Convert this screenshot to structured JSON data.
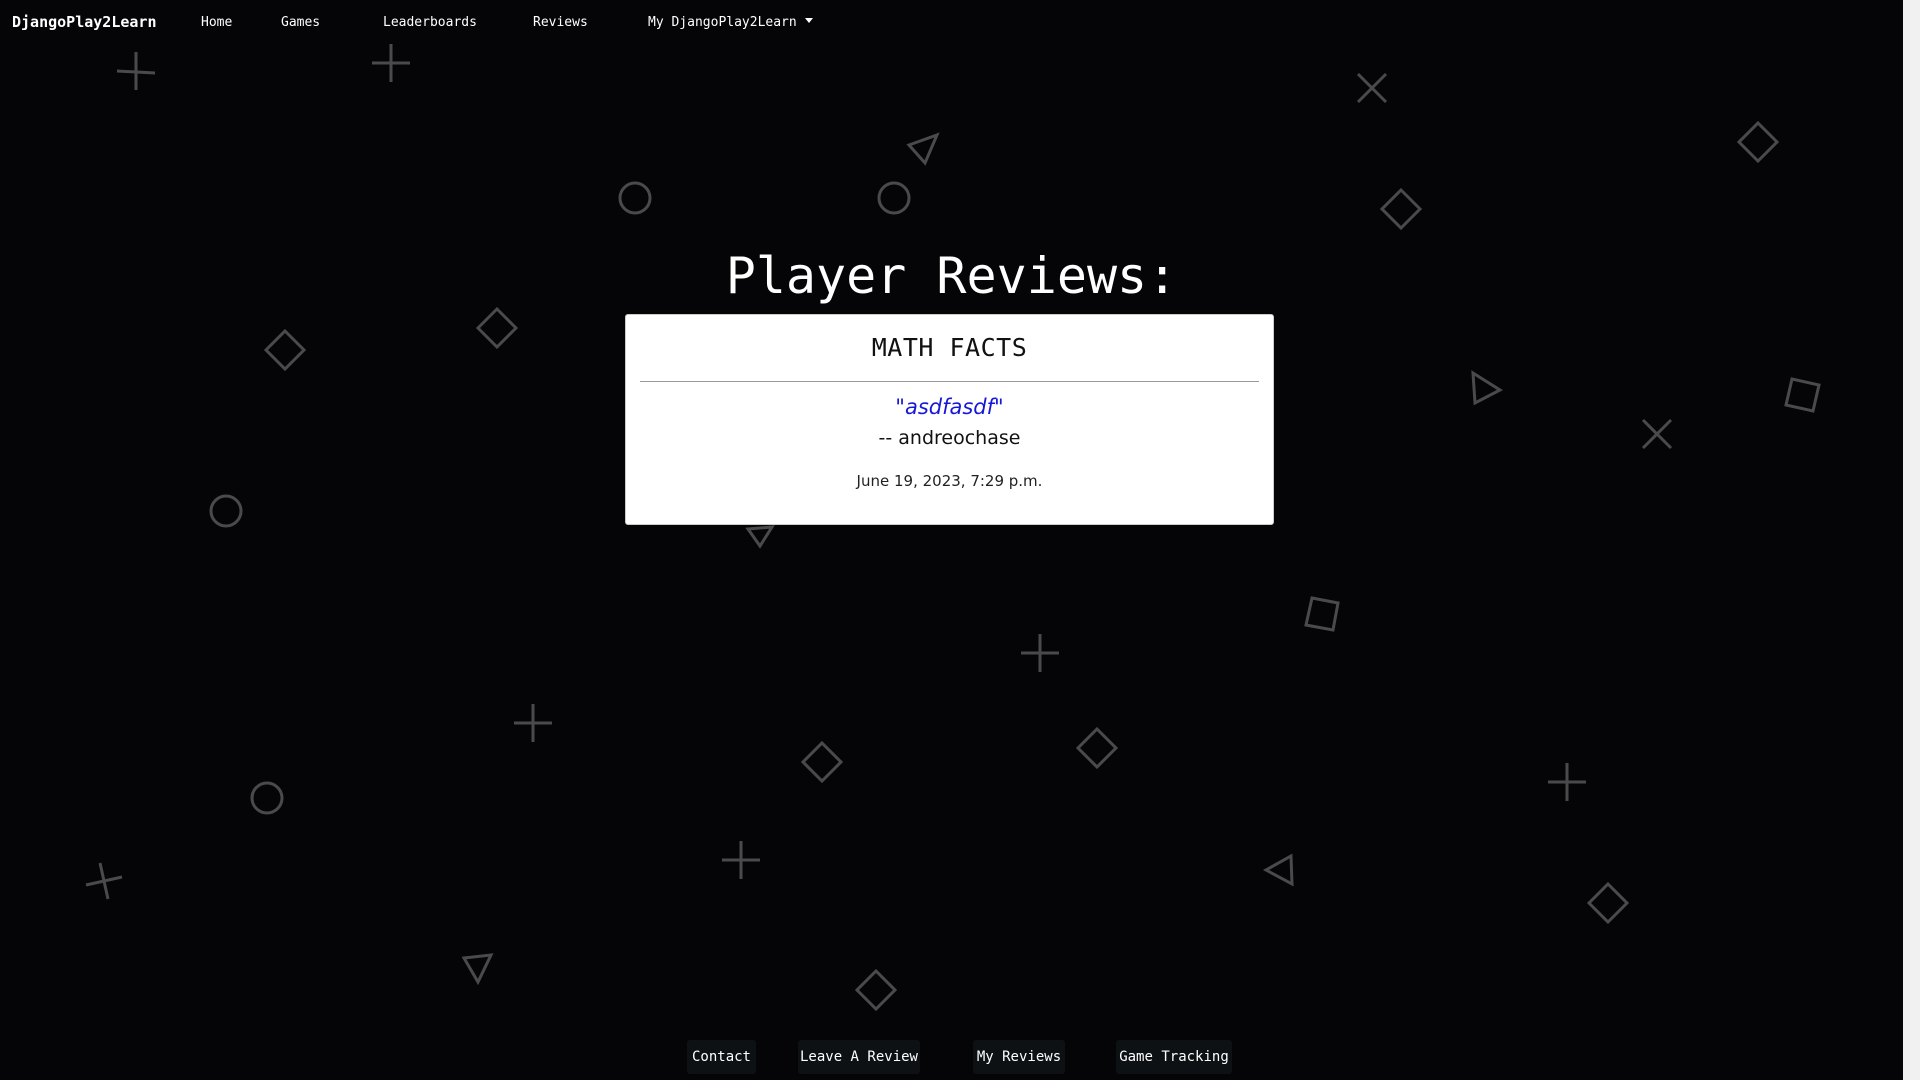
{
  "nav": {
    "brand": "DjangoPlay2Learn",
    "items": [
      {
        "label": "Home"
      },
      {
        "label": "Games"
      },
      {
        "label": "Leaderboards"
      },
      {
        "label": "Reviews"
      },
      {
        "label": "My DjangoPlay2Learn"
      }
    ]
  },
  "page": {
    "title": "Player Reviews:"
  },
  "review": {
    "game": "MATH FACTS",
    "text": "\"asdfasdf\"",
    "author": "-- andreochase",
    "date": "June 19, 2023, 7:29 p.m."
  },
  "footer": {
    "buttons": [
      {
        "label": "Contact"
      },
      {
        "label": "Leave A Review"
      },
      {
        "label": "My Reviews"
      },
      {
        "label": "Game Tracking"
      }
    ]
  },
  "colors": {
    "background": "#050507",
    "review_text": "#1717d6",
    "shape_stroke": "#4a4a4a"
  },
  "background_shape_icons": [
    "plus-icon",
    "cross-icon",
    "circle-icon",
    "triangle-icon",
    "diamond-icon",
    "square-icon"
  ]
}
